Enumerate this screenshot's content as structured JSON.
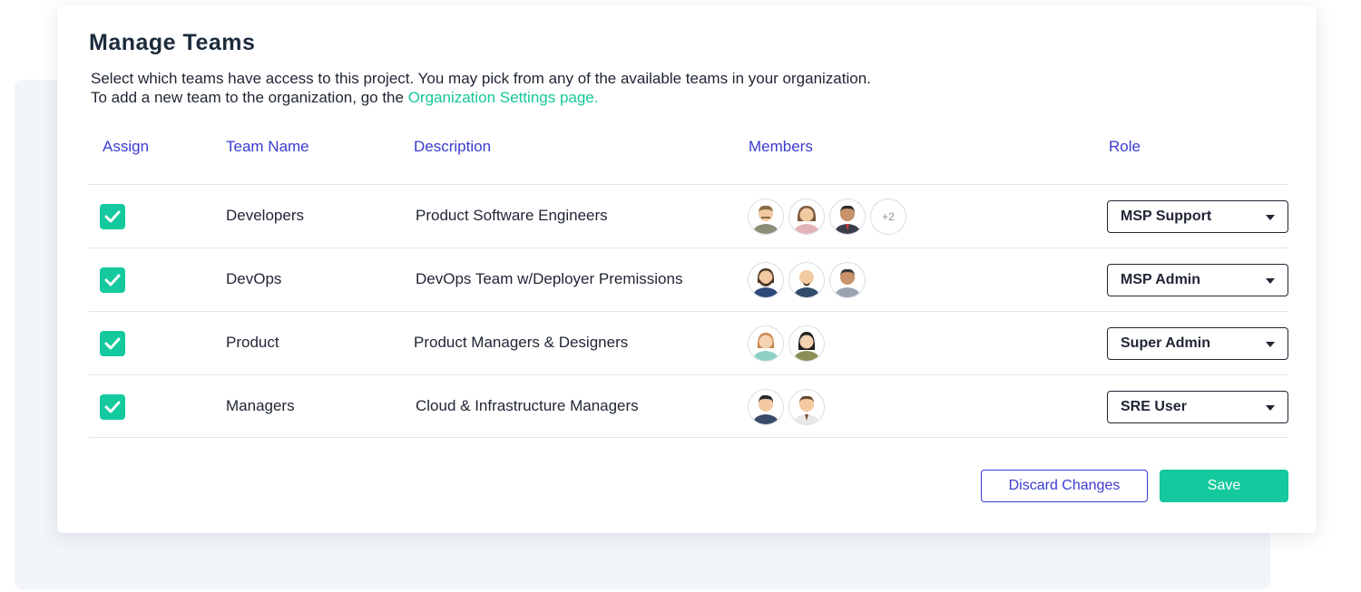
{
  "page": {
    "title": "Manage Teams",
    "description_line1": "Select which teams have access to this project. You may pick from any of the available teams in your organization.",
    "description_line2_prefix": "To add a new team to the organization, go the ",
    "description_link": "Organization Settings page."
  },
  "columns": {
    "assign": "Assign",
    "team_name": "Team Name",
    "description": "Description",
    "members": "Members",
    "role": "Role"
  },
  "teams": [
    {
      "name": "Developers",
      "description": "Product Software Engineers",
      "assigned": true,
      "role": "MSP Support",
      "more_members": "+2"
    },
    {
      "name": "DevOps",
      "description": "DevOps Team w/Deployer Premissions",
      "assigned": true,
      "role": "MSP Admin"
    },
    {
      "name": "Product",
      "description": "Product Managers & Designers",
      "assigned": true,
      "role": "Super Admin"
    },
    {
      "name": "Managers",
      "description": "Cloud & Infrastructure Managers",
      "assigned": true,
      "role": "SRE User"
    }
  ],
  "actions": {
    "discard": "Discard Changes",
    "save": "Save"
  },
  "colors": {
    "accent_green": "#14c99d",
    "link_green": "#15c79a",
    "header_blue": "#3b3bd0",
    "text_dark": "#1f2533"
  },
  "icons": {
    "checkbox": "checkmark-icon",
    "avatar": "person-avatar-icon",
    "dropdown": "caret-down-icon"
  }
}
